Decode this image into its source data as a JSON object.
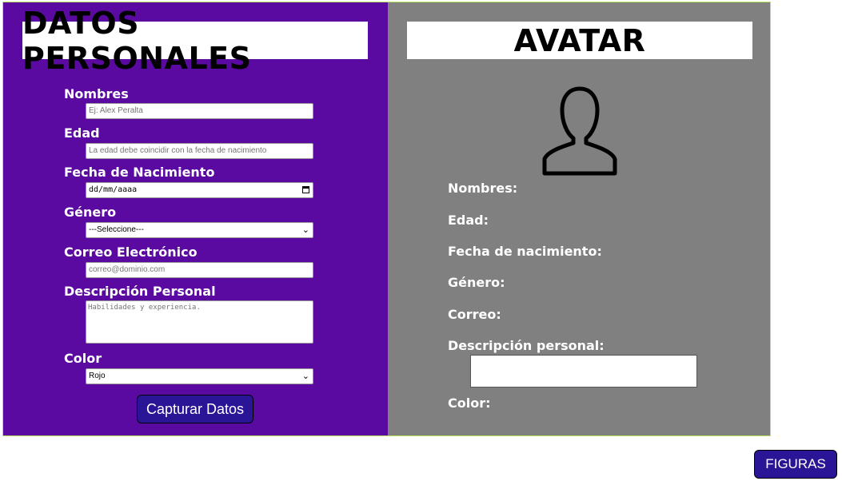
{
  "form": {
    "title": "DATOS PERSONALES",
    "fields": {
      "nombres": {
        "label": "Nombres",
        "placeholder": "Ej: Alex Peralta"
      },
      "edad": {
        "label": "Edad",
        "placeholder": "La edad debe coincidir con la fecha de nacimiento"
      },
      "fecha": {
        "label": "Fecha de Nacimiento",
        "value": "dd/mm/aaaa"
      },
      "genero": {
        "label": "Género",
        "value": "---Seleccione---"
      },
      "correo": {
        "label": "Correo Electrónico",
        "placeholder": "correo@dominio.com"
      },
      "descripcion": {
        "label": "Descripción Personal",
        "placeholder": "Habilidades y experiencia."
      },
      "color": {
        "label": "Color",
        "value": "Rojo"
      }
    },
    "submit_label": "Capturar Datos"
  },
  "avatar": {
    "title": "AVATAR",
    "icon": "user-silhouette-icon",
    "labels": {
      "nombres": "Nombres:",
      "edad": "Edad:",
      "fecha": "Fecha de nacimiento:",
      "genero": "Género:",
      "correo": "Correo:",
      "descripcion": "Descripción personal:",
      "color": "Color:"
    }
  },
  "footer": {
    "figuras_label": "FIGURAS"
  },
  "colors": {
    "left_panel": "#5a0aa0",
    "right_panel": "#808080",
    "button": "#2a1596",
    "frame_border": "#b6e35a"
  }
}
